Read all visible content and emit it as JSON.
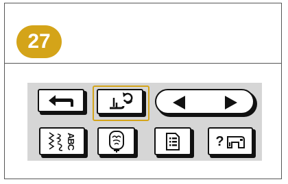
{
  "step": {
    "number": "27"
  },
  "colors": {
    "accent": "#d4a419",
    "panel": "#d6d6d6",
    "stroke": "#111111"
  },
  "buttons": {
    "row1": [
      {
        "name": "back-button",
        "icon": "return-arrow-icon"
      },
      {
        "name": "presser-foot-exchange-button",
        "icon": "presser-foot-replace-icon",
        "selected": true
      },
      {
        "name": "page-navigation",
        "icon": "left-right-arrows-icon"
      }
    ],
    "row2": [
      {
        "name": "stitch-select-button",
        "icon": "stitch-letters-icon"
      },
      {
        "name": "embroidery-button",
        "icon": "embroidery-hoop-icon"
      },
      {
        "name": "memory-button",
        "icon": "document-list-icon"
      },
      {
        "name": "help-button",
        "icon": "machine-help-icon"
      }
    ]
  },
  "stitch_label": {
    "text": "ABC"
  },
  "help_label": {
    "text": "?"
  }
}
